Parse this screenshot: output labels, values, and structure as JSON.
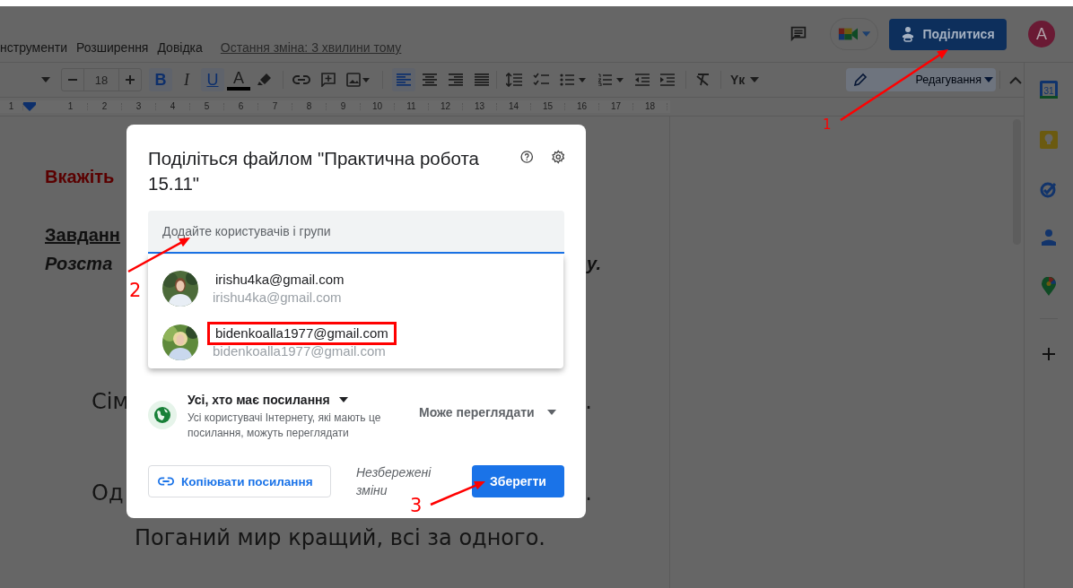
{
  "menu": [
    {
      "label": "нструменти"
    },
    {
      "label": "Розширення"
    },
    {
      "label": "Довідка"
    }
  ],
  "last_edit": "Остання зміна: 3 хвилини тому",
  "share_button": "Поділитися",
  "account_initial": "A",
  "toolbar": {
    "font_size": "18",
    "format": [
      {
        "kind": "bold",
        "label": "B",
        "selected": true
      },
      {
        "kind": "italic",
        "label": "I",
        "selected": false
      },
      {
        "kind": "underline",
        "label": "U",
        "selected": true
      },
      {
        "kind": "text_color",
        "label": "A",
        "selected": false
      }
    ],
    "align": [
      {
        "kind": "left",
        "selected": true
      },
      {
        "kind": "center",
        "selected": false
      },
      {
        "kind": "right",
        "selected": false
      },
      {
        "kind": "justify",
        "selected": false
      }
    ],
    "input_tools": "Yк",
    "mode": "Редагування"
  },
  "ruler": [
    "1",
    "1",
    "2",
    "3",
    "4",
    "5",
    "6",
    "7",
    "8",
    "9",
    "10",
    "11",
    "12",
    "13",
    "14",
    "15",
    "16",
    "17",
    "18"
  ],
  "sidebar": {
    "calendar_day": "31"
  },
  "document": [
    {
      "kind": "heading",
      "left": "Вкажіть"
    },
    {
      "kind": "underlined",
      "left": "Завданн"
    },
    {
      "kind": "italic",
      "left": "Розста",
      "right": "у."
    },
    {
      "kind": "verse",
      "left": "Сім",
      "right": "."
    },
    {
      "kind": "verse",
      "left": "Од",
      "right": "."
    },
    {
      "kind": "centered",
      "left": "Поганий мир кращий, всі за одного."
    }
  ],
  "dialog": {
    "title": "Поділіться файлом \"Практична робота 15.11\"",
    "people_field": {
      "placeholder": "Додайте користувачів і групи"
    },
    "suggestions": [
      {
        "name": "irishu4ka@gmail.com",
        "email": "irishu4ka@gmail.com",
        "highlighted": false
      },
      {
        "name": "bidenkoalla1977@gmail.com",
        "email": "bidenkoalla1977@gmail.com",
        "highlighted": true
      }
    ],
    "general_access": {
      "scope": "Усі, хто має посилання",
      "description": "Усі користувачі Інтернету, які мають це посилання, можуть переглядати",
      "role": "Може переглядати"
    },
    "copy_link": "Копіювати посилання",
    "status": "Незбережені зміни",
    "save": "Зберегти"
  },
  "annotations": [
    {
      "label": "1"
    },
    {
      "label": "2"
    },
    {
      "label": "3"
    }
  ]
}
